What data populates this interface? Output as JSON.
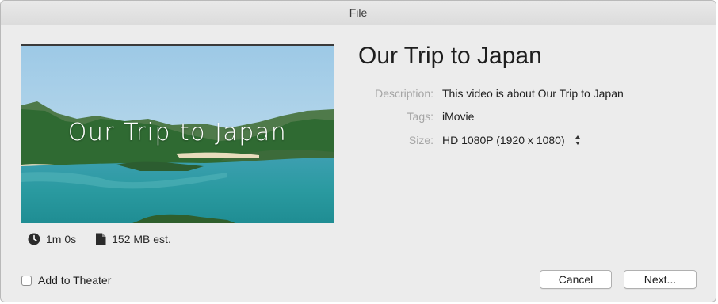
{
  "window": {
    "title": "File"
  },
  "preview": {
    "overlay_title": "Our Trip to Japan"
  },
  "meta": {
    "duration": "1m 0s",
    "file_size": "152 MB est."
  },
  "project": {
    "title": "Our Trip to Japan",
    "description_label": "Description:",
    "description_value": "This video is about Our Trip to Japan",
    "tags_label": "Tags:",
    "tags_value": "iMovie",
    "size_label": "Size:",
    "size_value": "HD 1080P (1920 x 1080)"
  },
  "footer": {
    "add_to_theater_label": "Add to Theater",
    "add_to_theater_checked": false,
    "cancel_label": "Cancel",
    "next_label": "Next..."
  },
  "icons": {
    "duration": "clock-icon",
    "file_size": "document-icon",
    "size_stepper": "up-down-stepper-icon"
  }
}
